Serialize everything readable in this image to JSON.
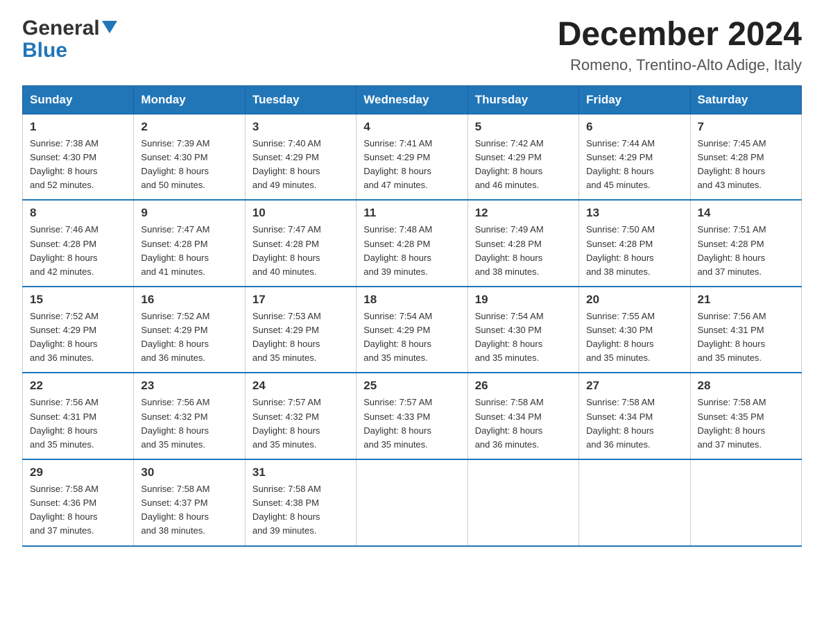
{
  "header": {
    "logo_general": "General",
    "logo_blue": "Blue",
    "title": "December 2024",
    "subtitle": "Romeno, Trentino-Alto Adige, Italy"
  },
  "days_of_week": [
    "Sunday",
    "Monday",
    "Tuesday",
    "Wednesday",
    "Thursday",
    "Friday",
    "Saturday"
  ],
  "weeks": [
    [
      {
        "day": "1",
        "sunrise": "7:38 AM",
        "sunset": "4:30 PM",
        "daylight": "8 hours and 52 minutes."
      },
      {
        "day": "2",
        "sunrise": "7:39 AM",
        "sunset": "4:30 PM",
        "daylight": "8 hours and 50 minutes."
      },
      {
        "day": "3",
        "sunrise": "7:40 AM",
        "sunset": "4:29 PM",
        "daylight": "8 hours and 49 minutes."
      },
      {
        "day": "4",
        "sunrise": "7:41 AM",
        "sunset": "4:29 PM",
        "daylight": "8 hours and 47 minutes."
      },
      {
        "day": "5",
        "sunrise": "7:42 AM",
        "sunset": "4:29 PM",
        "daylight": "8 hours and 46 minutes."
      },
      {
        "day": "6",
        "sunrise": "7:44 AM",
        "sunset": "4:29 PM",
        "daylight": "8 hours and 45 minutes."
      },
      {
        "day": "7",
        "sunrise": "7:45 AM",
        "sunset": "4:28 PM",
        "daylight": "8 hours and 43 minutes."
      }
    ],
    [
      {
        "day": "8",
        "sunrise": "7:46 AM",
        "sunset": "4:28 PM",
        "daylight": "8 hours and 42 minutes."
      },
      {
        "day": "9",
        "sunrise": "7:47 AM",
        "sunset": "4:28 PM",
        "daylight": "8 hours and 41 minutes."
      },
      {
        "day": "10",
        "sunrise": "7:47 AM",
        "sunset": "4:28 PM",
        "daylight": "8 hours and 40 minutes."
      },
      {
        "day": "11",
        "sunrise": "7:48 AM",
        "sunset": "4:28 PM",
        "daylight": "8 hours and 39 minutes."
      },
      {
        "day": "12",
        "sunrise": "7:49 AM",
        "sunset": "4:28 PM",
        "daylight": "8 hours and 38 minutes."
      },
      {
        "day": "13",
        "sunrise": "7:50 AM",
        "sunset": "4:28 PM",
        "daylight": "8 hours and 38 minutes."
      },
      {
        "day": "14",
        "sunrise": "7:51 AM",
        "sunset": "4:28 PM",
        "daylight": "8 hours and 37 minutes."
      }
    ],
    [
      {
        "day": "15",
        "sunrise": "7:52 AM",
        "sunset": "4:29 PM",
        "daylight": "8 hours and 36 minutes."
      },
      {
        "day": "16",
        "sunrise": "7:52 AM",
        "sunset": "4:29 PM",
        "daylight": "8 hours and 36 minutes."
      },
      {
        "day": "17",
        "sunrise": "7:53 AM",
        "sunset": "4:29 PM",
        "daylight": "8 hours and 35 minutes."
      },
      {
        "day": "18",
        "sunrise": "7:54 AM",
        "sunset": "4:29 PM",
        "daylight": "8 hours and 35 minutes."
      },
      {
        "day": "19",
        "sunrise": "7:54 AM",
        "sunset": "4:30 PM",
        "daylight": "8 hours and 35 minutes."
      },
      {
        "day": "20",
        "sunrise": "7:55 AM",
        "sunset": "4:30 PM",
        "daylight": "8 hours and 35 minutes."
      },
      {
        "day": "21",
        "sunrise": "7:56 AM",
        "sunset": "4:31 PM",
        "daylight": "8 hours and 35 minutes."
      }
    ],
    [
      {
        "day": "22",
        "sunrise": "7:56 AM",
        "sunset": "4:31 PM",
        "daylight": "8 hours and 35 minutes."
      },
      {
        "day": "23",
        "sunrise": "7:56 AM",
        "sunset": "4:32 PM",
        "daylight": "8 hours and 35 minutes."
      },
      {
        "day": "24",
        "sunrise": "7:57 AM",
        "sunset": "4:32 PM",
        "daylight": "8 hours and 35 minutes."
      },
      {
        "day": "25",
        "sunrise": "7:57 AM",
        "sunset": "4:33 PM",
        "daylight": "8 hours and 35 minutes."
      },
      {
        "day": "26",
        "sunrise": "7:58 AM",
        "sunset": "4:34 PM",
        "daylight": "8 hours and 36 minutes."
      },
      {
        "day": "27",
        "sunrise": "7:58 AM",
        "sunset": "4:34 PM",
        "daylight": "8 hours and 36 minutes."
      },
      {
        "day": "28",
        "sunrise": "7:58 AM",
        "sunset": "4:35 PM",
        "daylight": "8 hours and 37 minutes."
      }
    ],
    [
      {
        "day": "29",
        "sunrise": "7:58 AM",
        "sunset": "4:36 PM",
        "daylight": "8 hours and 37 minutes."
      },
      {
        "day": "30",
        "sunrise": "7:58 AM",
        "sunset": "4:37 PM",
        "daylight": "8 hours and 38 minutes."
      },
      {
        "day": "31",
        "sunrise": "7:58 AM",
        "sunset": "4:38 PM",
        "daylight": "8 hours and 39 minutes."
      },
      null,
      null,
      null,
      null
    ]
  ],
  "labels": {
    "sunrise": "Sunrise:",
    "sunset": "Sunset:",
    "daylight": "Daylight:"
  }
}
